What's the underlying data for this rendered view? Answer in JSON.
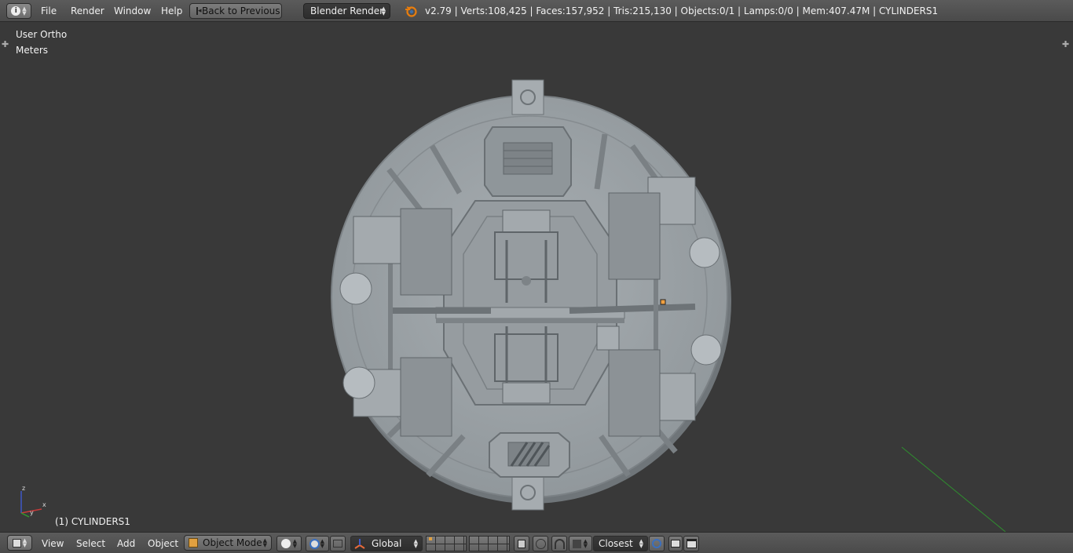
{
  "top_menu": {
    "items": [
      "File",
      "Render",
      "Window",
      "Help"
    ],
    "back_button": "Back to Previous",
    "render_engine": "Blender Render"
  },
  "stats": {
    "text": "v2.79 | Verts:108,425 | Faces:157,952 | Tris:215,130 | Objects:0/1 | Lamps:0/0 | Mem:407.47M | CYLINDERS1"
  },
  "viewport": {
    "view_name": "User Ortho",
    "units": "Meters",
    "object_label": "(1) CYLINDERS1",
    "axis_labels": {
      "z": "z",
      "x": "x",
      "y": "y"
    }
  },
  "bottom_menu": {
    "items": [
      "View",
      "Select",
      "Add",
      "Object"
    ],
    "mode": "Object Mode",
    "orientation": "Global",
    "snap_target": "Closest"
  },
  "colors": {
    "header": "#4e4e4e",
    "viewport_bg": "#393939",
    "model": "#9aa0a4",
    "axis_green": "#2f8f2f"
  }
}
